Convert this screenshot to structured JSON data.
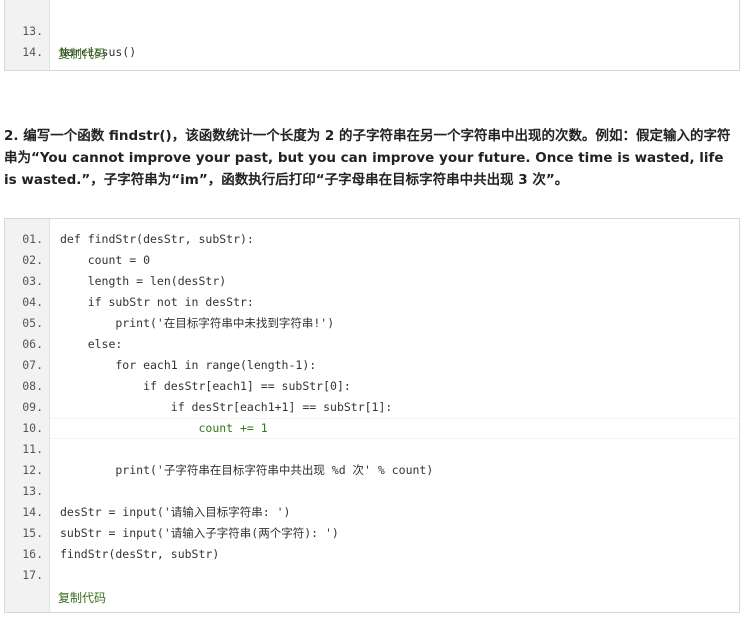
{
  "snippet1": {
    "lines": [
      {
        "num": "13.",
        "code": "Narcissus()"
      },
      {
        "num": "14.",
        "code": ""
      }
    ],
    "copy_label": "复制代码"
  },
  "question": {
    "text": "2. 编写一个函数 findstr()，该函数统计一个长度为 2 的子字符串在另一个字符串中出现的次数。例如：假定输入的字符串为“You cannot improve your past, but you can improve your future. Once time is wasted, life is wasted.”，子字符串为“im”，函数执行后打印“子字母串在目标字符串中共出现 3 次”。"
  },
  "snippet2": {
    "lines": [
      {
        "num": "01.",
        "code": "def findStr(desStr, subStr):"
      },
      {
        "num": "02.",
        "code": "    count = 0"
      },
      {
        "num": "03.",
        "code": "    length = len(desStr)"
      },
      {
        "num": "04.",
        "code": "    if subStr not in desStr:"
      },
      {
        "num": "05.",
        "code": "        print('在目标字符串中未找到字符串!')"
      },
      {
        "num": "06.",
        "code": "    else:"
      },
      {
        "num": "07.",
        "code": "        for each1 in range(length-1):"
      },
      {
        "num": "08.",
        "code": "            if desStr[each1] == subStr[0]:"
      },
      {
        "num": "09.",
        "code": "                if desStr[each1+1] == subStr[1]:"
      },
      {
        "num": "10.",
        "code": "                    count += 1"
      },
      {
        "num": "11.",
        "code": ""
      },
      {
        "num": "12.",
        "code": "        print('子字符串在目标字符串中共出现 %d 次' % count)"
      },
      {
        "num": "13.",
        "code": ""
      },
      {
        "num": "14.",
        "code": "desStr = input('请输入目标字符串: ')"
      },
      {
        "num": "15.",
        "code": "subStr = input('请输入子字符串(两个字符): ')"
      },
      {
        "num": "16.",
        "code": "findStr(desStr, subStr)"
      },
      {
        "num": "17.",
        "code": ""
      }
    ],
    "highlighted_line": "10.",
    "copy_label": "复制代码"
  },
  "colors": {
    "gutter_bg": "#f2f2f2",
    "border": "#d7d7d7",
    "copy_link": "#3a6e1c",
    "highlight_text": "#2e7a18"
  }
}
